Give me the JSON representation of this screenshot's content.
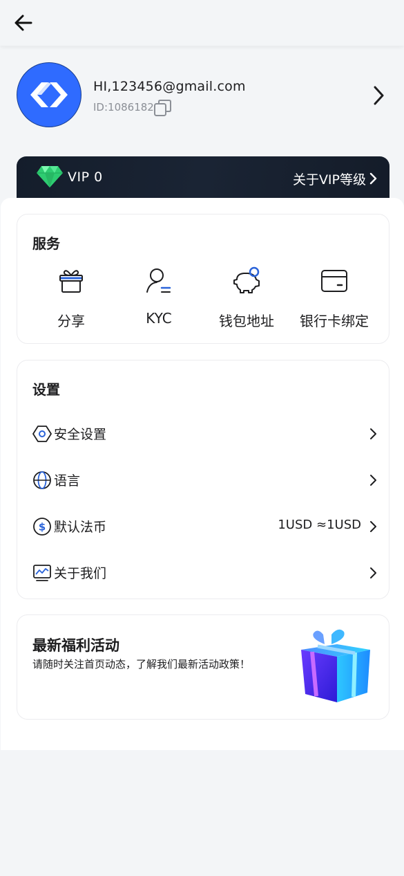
{
  "header": {
    "back_icon": "arrow-left-icon"
  },
  "profile": {
    "email": "HI,123456@gmail.com",
    "id_text": "ID:1086182",
    "avatar_icon": "app-logo",
    "copy_icon": "copy-icon",
    "arrow_icon": "chevron-right-icon"
  },
  "vip": {
    "level": "VIP 0",
    "about_label": "关于VIP等级",
    "gem_icon": "diamond-icon"
  },
  "services": {
    "title": "服务",
    "items": [
      {
        "label": "分享",
        "icon": "gift-icon"
      },
      {
        "label": "KYC",
        "icon": "user-verify-icon"
      },
      {
        "label": "钱包地址",
        "icon": "piggy-bank-icon"
      },
      {
        "label": "银行卡绑定",
        "icon": "bank-card-icon"
      }
    ]
  },
  "settings": {
    "title": "设置",
    "items": [
      {
        "label": "安全设置",
        "value": "",
        "icon": "shield-hex-icon"
      },
      {
        "label": "语言",
        "value": "",
        "icon": "globe-icon"
      },
      {
        "label": "默认法币",
        "value": "1USD ≈1USD",
        "icon": "dollar-icon"
      },
      {
        "label": "关于我们",
        "value": "",
        "icon": "monitor-chart-icon"
      }
    ]
  },
  "promo": {
    "title": "最新福利活动",
    "description": "请随时关注首页动态，了解我们最新活动政策！",
    "image": "gift-box-illustration"
  },
  "colors": {
    "accent": "#2f6bff",
    "vip_bg": "#141d2b",
    "gem": "#3ddc84",
    "icon_blue": "#2a63d9"
  }
}
